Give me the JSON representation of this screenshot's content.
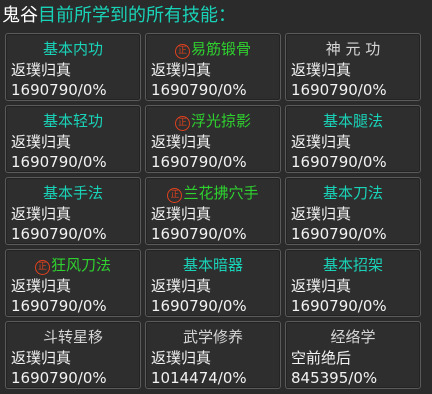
{
  "header": {
    "character_name": "鬼谷",
    "title": "目前所学到的所有技能："
  },
  "colors": {
    "cyan": "#19d3b8",
    "green": "#2fd12f",
    "badge_red": "#e0411e"
  },
  "skills": [
    {
      "name": "基本内功",
      "color": "cyan",
      "special": false,
      "level": "返璞归真",
      "exp": "1690790/0%"
    },
    {
      "name": "易筋锻骨",
      "color": "green",
      "special": true,
      "badge": "正",
      "level": "返璞归真",
      "exp": "1690790/0%"
    },
    {
      "name": "神 元 功",
      "color": "gray",
      "special": false,
      "level": "返璞归真",
      "exp": "1690790/0%"
    },
    {
      "name": "基本轻功",
      "color": "cyan",
      "special": false,
      "level": "返璞归真",
      "exp": "1690790/0%"
    },
    {
      "name": "浮光掠影",
      "color": "green",
      "special": true,
      "badge": "正",
      "level": "返璞归真",
      "exp": "1690790/0%"
    },
    {
      "name": "基本腿法",
      "color": "cyan",
      "special": false,
      "level": "返璞归真",
      "exp": "1690790/0%"
    },
    {
      "name": "基本手法",
      "color": "cyan",
      "special": false,
      "level": "返璞归真",
      "exp": "1690790/0%"
    },
    {
      "name": "兰花拂穴手",
      "color": "green",
      "special": true,
      "badge": "正",
      "level": "返璞归真",
      "exp": "1690790/0%"
    },
    {
      "name": "基本刀法",
      "color": "cyan",
      "special": false,
      "level": "返璞归真",
      "exp": "1690790/0%"
    },
    {
      "name": "狂风刀法",
      "color": "green",
      "special": true,
      "badge": "正",
      "level": "返璞归真",
      "exp": "1690790/0%"
    },
    {
      "name": "基本暗器",
      "color": "cyan",
      "special": false,
      "level": "返璞归真",
      "exp": "1690790/0%"
    },
    {
      "name": "基本招架",
      "color": "cyan",
      "special": false,
      "level": "返璞归真",
      "exp": "1690790/0%"
    },
    {
      "name": "斗转星移",
      "color": "gray",
      "special": false,
      "level": "返璞归真",
      "exp": "1690790/0%"
    },
    {
      "name": "武学修养",
      "color": "gray",
      "special": false,
      "level": "返璞归真",
      "exp": "1014474/0%"
    },
    {
      "name": "经络学",
      "color": "gray",
      "special": false,
      "level": "空前绝后",
      "exp": "845395/0%"
    }
  ]
}
